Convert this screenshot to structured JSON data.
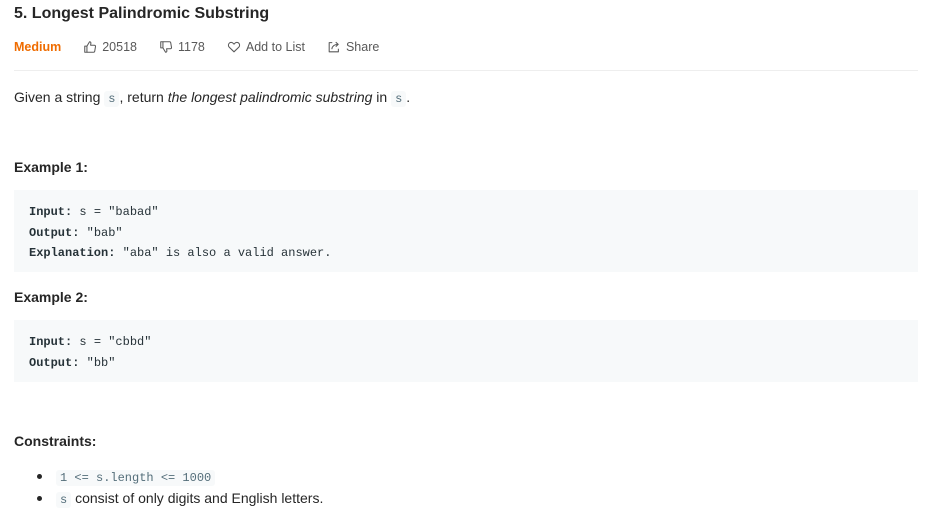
{
  "problem": {
    "title": "5. Longest Palindromic Substring",
    "difficulty": "Medium",
    "likes": "20518",
    "dislikes": "1178",
    "add_to_list": "Add to List",
    "share": "Share"
  },
  "description": {
    "part1": "Given a string ",
    "code1": "s",
    "part2": ", return ",
    "emphasis": "the longest palindromic substring",
    "part3": " in ",
    "code2": "s",
    "part4": "."
  },
  "examples": [
    {
      "title": "Example 1:",
      "input_label": "Input:",
      "input_value": " s = \"babad\"",
      "output_label": "Output:",
      "output_value": " \"bab\"",
      "explanation_label": "Explanation:",
      "explanation_value": " \"aba\" is also a valid answer."
    },
    {
      "title": "Example 2:",
      "input_label": "Input:",
      "input_value": " s = \"cbbd\"",
      "output_label": "Output:",
      "output_value": " \"bb\""
    }
  ],
  "constraints": {
    "title": "Constraints:",
    "items": [
      {
        "code": "1 <= s.length <= 1000",
        "text": ""
      },
      {
        "code": "s",
        "text": " consist of only digits and English letters."
      }
    ]
  },
  "colors": {
    "difficulty_medium": "#ef6c00",
    "code_background": "#f7f9fa"
  }
}
